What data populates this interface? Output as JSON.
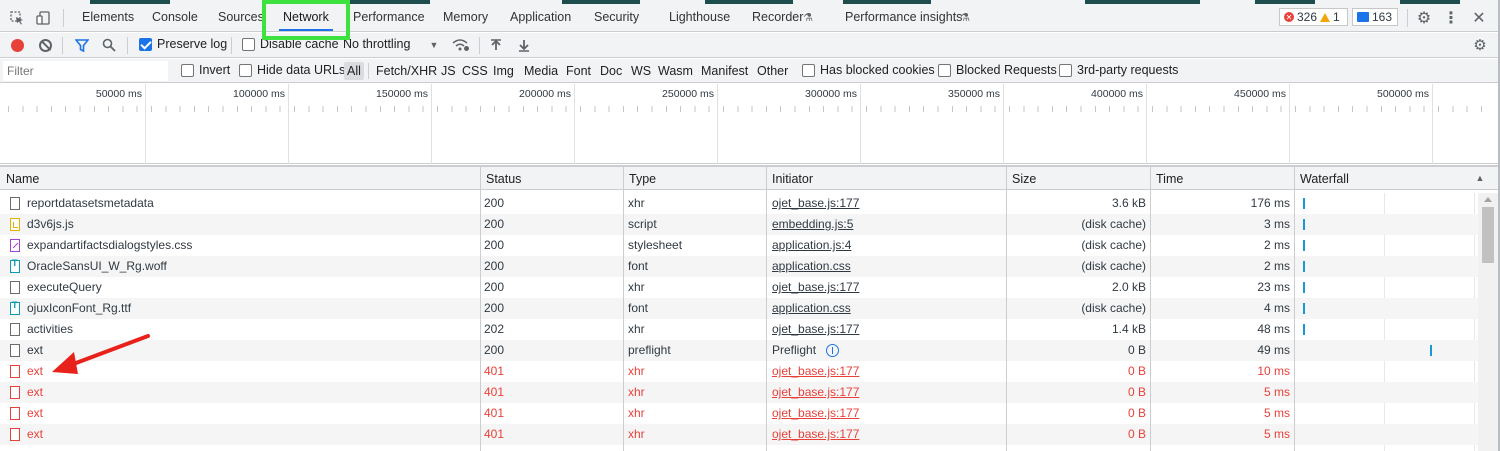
{
  "tabs": [
    {
      "label": "Elements"
    },
    {
      "label": "Console"
    },
    {
      "label": "Sources"
    },
    {
      "label": "Network"
    },
    {
      "label": "Performance"
    },
    {
      "label": "Memory"
    },
    {
      "label": "Application"
    },
    {
      "label": "Security"
    },
    {
      "label": "Lighthouse"
    },
    {
      "label": "Recorder"
    },
    {
      "label": "Performance insights"
    }
  ],
  "active_tab": "Network",
  "counters": {
    "errors": "326",
    "warnings": "1",
    "messages": "163"
  },
  "toolbar": {
    "preserve_log": "Preserve log",
    "disable_cache": "Disable cache",
    "throttling": "No throttling"
  },
  "filter": {
    "placeholder": "Filter",
    "invert": "Invert",
    "hide_data_urls": "Hide data URLs",
    "types": [
      "All",
      "Fetch/XHR",
      "JS",
      "CSS",
      "Img",
      "Media",
      "Font",
      "Doc",
      "WS",
      "Wasm",
      "Manifest",
      "Other"
    ],
    "has_blocked_cookies": "Has blocked cookies",
    "blocked_requests": "Blocked Requests",
    "third_party": "3rd-party requests"
  },
  "overview": {
    "labels": [
      "50000 ms",
      "100000 ms",
      "150000 ms",
      "200000 ms",
      "250000 ms",
      "300000 ms",
      "350000 ms",
      "400000 ms",
      "450000 ms",
      "500000 ms"
    ]
  },
  "columns": {
    "name": "Name",
    "status": "Status",
    "type": "Type",
    "initiator": "Initiator",
    "size": "Size",
    "time": "Time",
    "waterfall": "Waterfall"
  },
  "rows": [
    {
      "name": "reportdatasetsmetadata",
      "status": "200",
      "type": "xhr",
      "initiator": "ojet_base.js:177",
      "size": "3.6 kB",
      "time": "176 ms",
      "icon": "doc",
      "error": false
    },
    {
      "name": "d3v6js.js",
      "status": "200",
      "type": "script",
      "initiator": "embedding.js:5",
      "size": "(disk cache)",
      "time": "3 ms",
      "icon": "script",
      "error": false
    },
    {
      "name": "expandartifactsdialogstyles.css",
      "status": "200",
      "type": "stylesheet",
      "initiator": "application.js:4",
      "size": "(disk cache)",
      "time": "2 ms",
      "icon": "css",
      "error": false
    },
    {
      "name": "OracleSansUI_W_Rg.woff",
      "status": "200",
      "type": "font",
      "initiator": "application.css",
      "size": "(disk cache)",
      "time": "2 ms",
      "icon": "font",
      "error": false
    },
    {
      "name": "executeQuery",
      "status": "200",
      "type": "xhr",
      "initiator": "ojet_base.js:177",
      "size": "2.0 kB",
      "time": "23 ms",
      "icon": "doc",
      "error": false
    },
    {
      "name": "ojuxIconFont_Rg.ttf",
      "status": "200",
      "type": "font",
      "initiator": "application.css",
      "size": "(disk cache)",
      "time": "4 ms",
      "icon": "font",
      "error": false
    },
    {
      "name": "activities",
      "status": "202",
      "type": "xhr",
      "initiator": "ojet_base.js:177",
      "size": "1.4 kB",
      "time": "48 ms",
      "icon": "doc",
      "error": false
    },
    {
      "name": "ext",
      "status": "200",
      "type": "preflight",
      "initiator": "Preflight",
      "size": "0 B",
      "time": "49 ms",
      "icon": "doc",
      "error": false
    },
    {
      "name": "ext",
      "status": "401",
      "type": "xhr",
      "initiator": "ojet_base.js:177",
      "size": "0 B",
      "time": "10 ms",
      "icon": "err",
      "error": true
    },
    {
      "name": "ext",
      "status": "401",
      "type": "xhr",
      "initiator": "ojet_base.js:177",
      "size": "0 B",
      "time": "5 ms",
      "icon": "err",
      "error": true
    },
    {
      "name": "ext",
      "status": "401",
      "type": "xhr",
      "initiator": "ojet_base.js:177",
      "size": "0 B",
      "time": "5 ms",
      "icon": "err",
      "error": true
    },
    {
      "name": "ext",
      "status": "401",
      "type": "xhr",
      "initiator": "ojet_base.js:177",
      "size": "0 B",
      "time": "5 ms",
      "icon": "err",
      "error": true
    }
  ],
  "colors": {
    "error": "#e8413a",
    "accent": "#1a73e8",
    "highlight": "#3ee23e"
  }
}
